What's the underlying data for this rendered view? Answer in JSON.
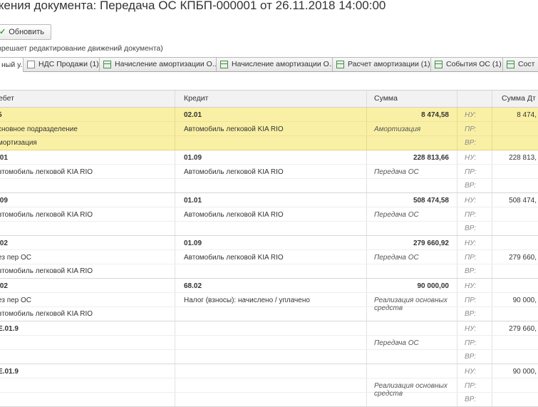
{
  "window": {
    "title": "жения документа: Передача ОС КПБП-000001 от 26.11.2018 14:00:00"
  },
  "toolbar": {
    "refresh_label": "Обновить"
  },
  "note": "зрешает редактирование движений документа)",
  "tabs": [
    {
      "label": "ный у...",
      "active": true
    },
    {
      "label": "НДС Продажи (1)"
    },
    {
      "label": "Начисление амортизации О..."
    },
    {
      "label": "Начисление амортизации О..."
    },
    {
      "label": "Расчет амортизации (1)"
    },
    {
      "label": "События ОС (1)"
    },
    {
      "label": "Сост"
    }
  ],
  "columns": {
    "debit": "ебет",
    "credit": "Кредит",
    "sum": "Сумма",
    "sum_dt": "Сумма Дт"
  },
  "labels": {
    "nu": "НУ:",
    "pr": "ПР:",
    "vr": "ВР:"
  },
  "rows": [
    {
      "selected": true,
      "debit": [
        "5",
        "сновное подразделение",
        "мортизация"
      ],
      "credit": [
        "02.01",
        "Автомобиль легковой KIA RIO",
        ""
      ],
      "sum": "8 474,58",
      "desc": "Амортизация",
      "nu": "8 474,"
    },
    {
      "debit": [
        ".01",
        "втомобиль легковой KIA RIO",
        ""
      ],
      "credit": [
        "01.09",
        "Автомобиль легковой KIA RIO",
        ""
      ],
      "sum": "228 813,66",
      "desc": "Передача ОС",
      "nu": "228 813,"
    },
    {
      "debit": [
        ".09",
        "втомобиль легковой KIA RIO",
        ""
      ],
      "credit": [
        "01.01",
        "Автомобиль легковой KIA RIO",
        ""
      ],
      "sum": "508 474,58",
      "desc": "Передача ОС",
      "nu": "508 474,"
    },
    {
      "debit": [
        ".02",
        "ез пер ОС",
        "втомобиль легковой KIA RIO"
      ],
      "credit": [
        "01.09",
        "Автомобиль легковой KIA RIO",
        ""
      ],
      "sum": "279 660,92",
      "desc": "Передача ОС",
      "pr": "279 660,"
    },
    {
      "debit": [
        ".02",
        "ез пер ОС",
        "втомобиль легковой KIA RIO"
      ],
      "credit": [
        "68.02",
        "Налог (взносы): начислено / уплачено",
        ""
      ],
      "sum": "90 000,00",
      "desc": "Реализация основных средств",
      "pr": "90 000,"
    },
    {
      "debit": [
        "Е.01.9",
        "",
        ""
      ],
      "credit": [
        "",
        "",
        ""
      ],
      "sum": "",
      "desc": "Передача ОС",
      "nu": "279 660,"
    },
    {
      "debit": [
        "Е.01.9",
        "",
        ""
      ],
      "credit": [
        "",
        "",
        ""
      ],
      "sum": "",
      "desc": "Реализация основных средств",
      "nu": "90 000,"
    }
  ]
}
